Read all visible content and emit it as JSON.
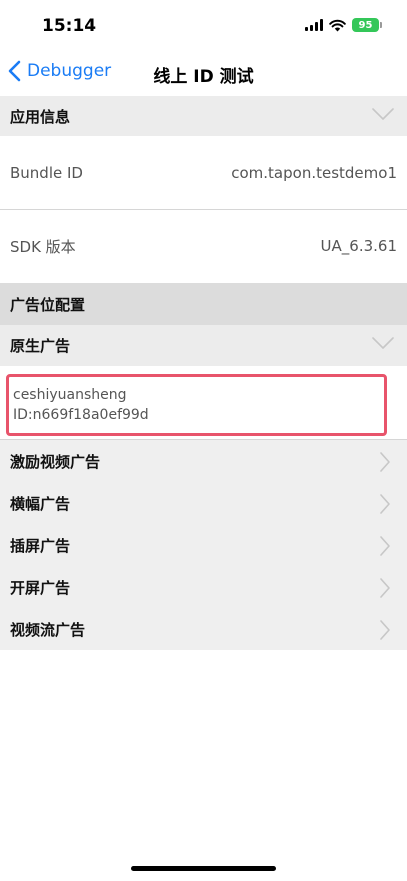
{
  "status_bar": {
    "time": "15:14",
    "battery": "95"
  },
  "nav": {
    "back_label": "Debugger",
    "title": "线上 ID 测试"
  },
  "app_info": {
    "header": "应用信息",
    "rows": [
      {
        "label": "Bundle ID",
        "value": "com.tapon.testdemo1"
      },
      {
        "label": "SDK 版本",
        "value": "UA_6.3.61"
      }
    ]
  },
  "ad_config": {
    "header": "广告位配置",
    "native": {
      "label": "原生广告",
      "item_name": "ceshiyuansheng",
      "item_id": "ID:n669f18a0ef99d"
    },
    "items": [
      {
        "label": "激励视频广告"
      },
      {
        "label": "横幅广告"
      },
      {
        "label": "插屏广告"
      },
      {
        "label": "开屏广告"
      },
      {
        "label": "视频流广告"
      }
    ]
  },
  "colors": {
    "accent": "#1a7cf5",
    "highlight_border": "#e8546b",
    "battery": "#34c759"
  }
}
